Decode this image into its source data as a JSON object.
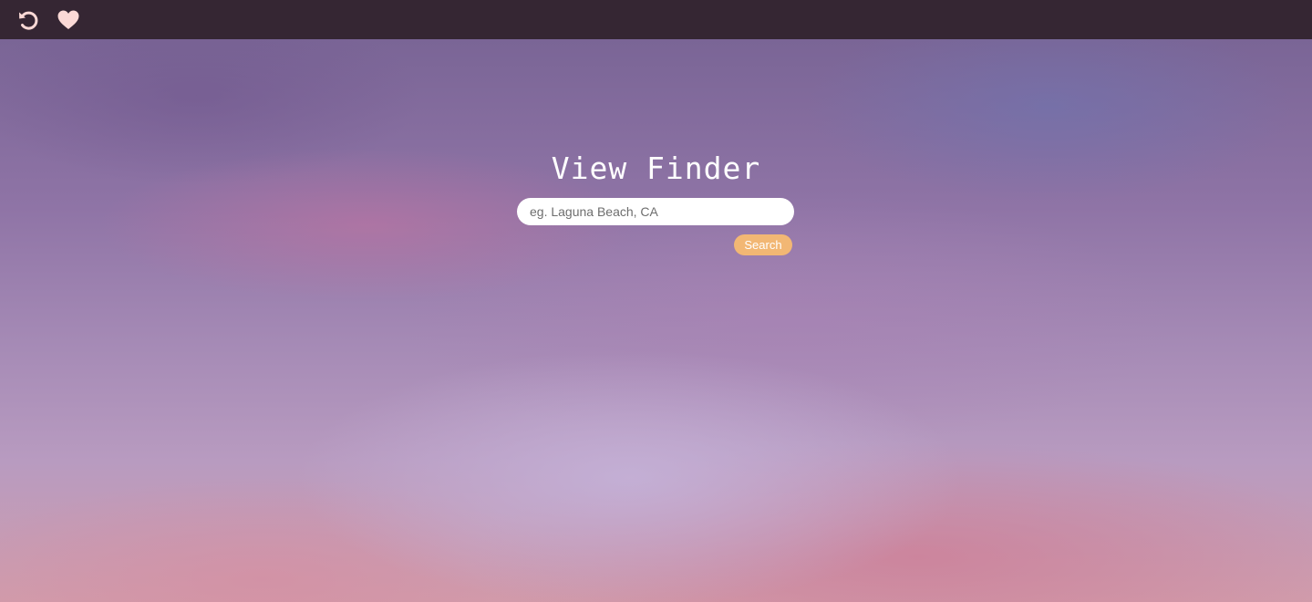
{
  "topbar": {
    "icons": [
      "refresh-icon",
      "heart-icon"
    ],
    "background": "#352633",
    "icon_color": "#fbd9d6"
  },
  "main": {
    "title": "View Finder",
    "search": {
      "placeholder": "eg. Laguna Beach, CA",
      "value": ""
    },
    "search_button_label": "Search",
    "button_color": "#f2b774"
  }
}
